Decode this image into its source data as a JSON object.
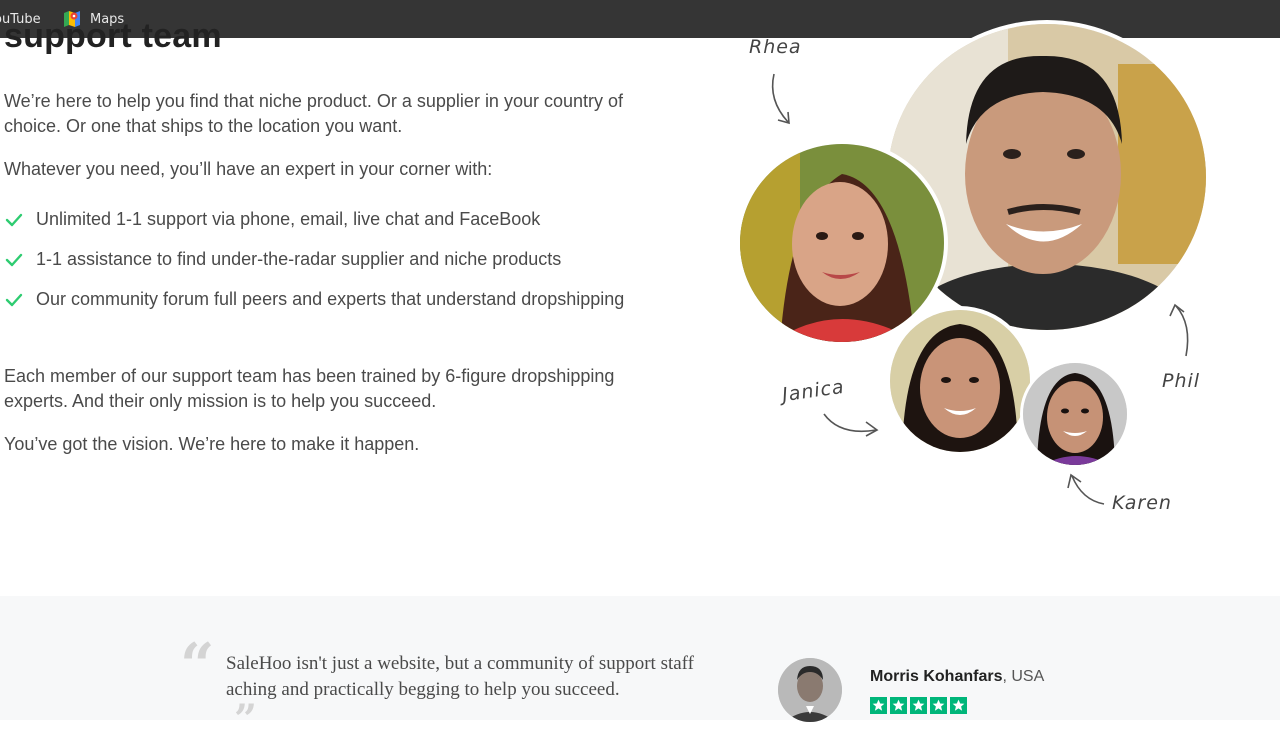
{
  "bookmarks": {
    "youtube_label": "ouTube",
    "maps_label": "Maps"
  },
  "section": {
    "heading": "support team",
    "intro": "We’re here to help you find that niche product. Or a supplier in your country of choice. Or one that ships to the location you want.",
    "lead": "Whatever you need, you’ll have an expert in your corner with:",
    "benefits": [
      "Unlimited 1-1 support via phone, email, live chat and FaceBook",
      "1-1 assistance to find under-the-radar supplier and niche products",
      "Our community forum full peers and experts that understand dropshipping"
    ],
    "training": "Each member of our support team has been trained by 6-figure dropshipping experts. And their only mission is to help you succeed.",
    "closing": "You’ve got the vision. We’re here to make it happen."
  },
  "team": {
    "rhea": "Rhea",
    "janica": "Janica",
    "phil": "Phil",
    "karen": "Karen"
  },
  "testimonial": {
    "quote": "SaleHoo isn't just a website, but a community of support staff aching and practically begging to help you succeed.",
    "name": "Morris Kohanfars",
    "country": ", USA",
    "rating": 5
  },
  "colors": {
    "check": "#2ecc71",
    "trustpilot": "#00b67a",
    "bookmark_bar": "#353535"
  }
}
